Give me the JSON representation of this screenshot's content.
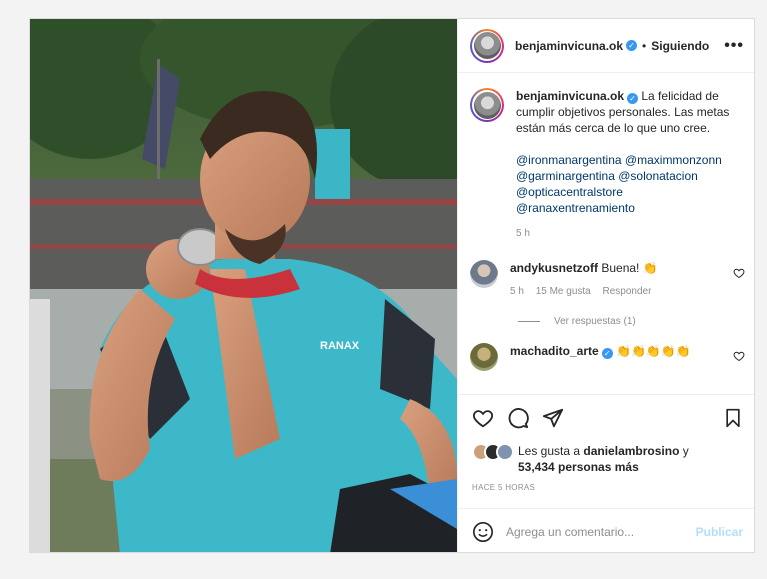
{
  "post": {
    "username": "benjaminvicuna.ok",
    "follow_status": "Siguiendo",
    "more_label": "•••",
    "caption_text": "La felicidad de cumplir objetivos personales. Las metas están más cerca de lo que uno cree.",
    "mentions": [
      "@ironmanargentina",
      "@maximmonzonn",
      "@garminargentina",
      "@solonatacion",
      "@opticacentralstore",
      "@ranaxentrenamiento"
    ],
    "caption_time": "5 h",
    "photo_text": {
      "jersey_brand": "RANAX"
    }
  },
  "comments": [
    {
      "username": "andykusnetzoff",
      "text": "Buena! 👏",
      "time": "5 h",
      "likes": "15 Me gusta",
      "reply_label": "Responder",
      "view_replies": "Ver respuestas (1)"
    },
    {
      "username": "machadito_arte",
      "text": "👏👏👏👏👏"
    }
  ],
  "likes": {
    "prefix": "Les gusta a",
    "user": "danielambrosino",
    "connector": "y",
    "others": "53,434 personas más"
  },
  "time_ago": "HACE 5 HORAS",
  "comment_box": {
    "placeholder": "Agrega un comentario...",
    "publish_label": "Publicar"
  },
  "colors": {
    "verified": "#3897f0",
    "link": "#00376b",
    "publish_disabled": "#b2dffc",
    "jersey": "#3db8c9"
  },
  "icons": [
    "heart-icon",
    "comment-icon",
    "share-icon",
    "bookmark-icon",
    "emoji-icon",
    "verified-badge-icon"
  ]
}
